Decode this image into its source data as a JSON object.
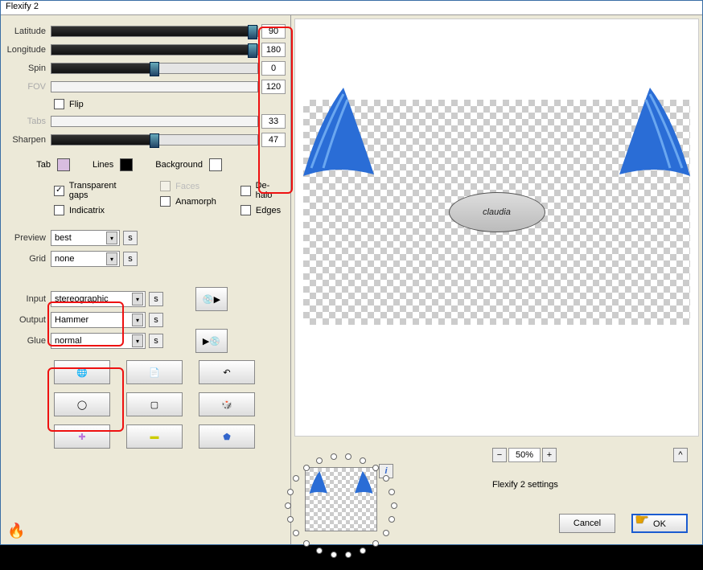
{
  "window": {
    "title": "Flexify 2"
  },
  "sliders": {
    "latitude": {
      "label": "Latitude",
      "value": "90",
      "fill": 100,
      "thumb": 100,
      "dim": false
    },
    "longitude": {
      "label": "Longitude",
      "value": "180",
      "fill": 100,
      "thumb": 100,
      "dim": false
    },
    "spin": {
      "label": "Spin",
      "value": "0",
      "fill": 50,
      "thumb": 50,
      "dim": false
    },
    "fov": {
      "label": "FOV",
      "value": "120",
      "fill": 0,
      "thumb": 0,
      "dim": true
    },
    "tabs": {
      "label": "Tabs",
      "value": "33",
      "fill": 0,
      "thumb": 0,
      "dim": true
    },
    "sharpen": {
      "label": "Sharpen",
      "value": "47",
      "fill": 50,
      "thumb": 50,
      "dim": false
    }
  },
  "flip": {
    "label": "Flip",
    "checked": false
  },
  "colors": {
    "tab": {
      "label": "Tab",
      "hex": "#d8bde0"
    },
    "lines": {
      "label": "Lines",
      "hex": "#000000"
    },
    "background": {
      "label": "Background",
      "hex": "#ffffff"
    }
  },
  "options": {
    "transparent_gaps": {
      "label": "Transparent gaps",
      "checked": true
    },
    "faces": {
      "label": "Faces",
      "checked": false,
      "dim": true
    },
    "dehalo": {
      "label": "De-halo",
      "checked": false
    },
    "indicatrix": {
      "label": "Indicatrix",
      "checked": false
    },
    "anamorph": {
      "label": "Anamorph",
      "checked": false
    },
    "edges": {
      "label": "Edges",
      "checked": false
    }
  },
  "combos": {
    "preview": {
      "label": "Preview",
      "value": "best"
    },
    "grid": {
      "label": "Grid",
      "value": "none"
    },
    "input": {
      "label": "Input",
      "value": "stereographic"
    },
    "output": {
      "label": "Output",
      "value": "Hammer"
    },
    "glue": {
      "label": "Glue",
      "value": "normal"
    }
  },
  "s_button": "s",
  "watermark": "claudia",
  "zoom": {
    "minus": "−",
    "value": "50%",
    "plus": "+",
    "caret": "^"
  },
  "settings_label": "Flexify 2 settings",
  "buttons": {
    "cancel": "Cancel",
    "ok": "OK"
  },
  "info_button": "i",
  "icons": {
    "globe": "globe-icon",
    "page": "page-icon",
    "undo": "undo-icon",
    "ring": "ring-icon",
    "frame": "frame-icon",
    "dice": "dice-icon",
    "plus": "plus-icon",
    "brick": "brick-icon",
    "gem": "gem-icon",
    "disc_play": "disc-play-icon",
    "play_disc": "play-disc-icon"
  }
}
